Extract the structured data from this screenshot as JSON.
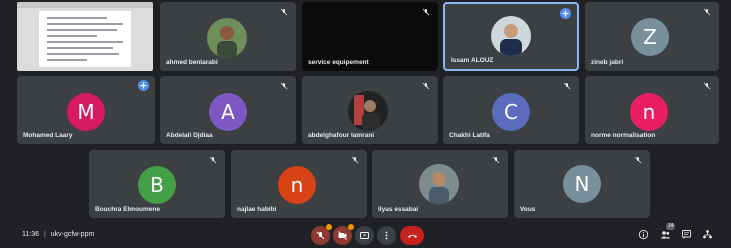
{
  "tiles": [
    {
      "name": "ahmed benlarabi"
    },
    {
      "name": "service equipement"
    },
    {
      "name": "Issam ALOUZ"
    },
    {
      "name": "zineb jabri",
      "initial": "Z",
      "color": "#78909c"
    },
    {
      "name": "Mohamed Laary",
      "initial": "M",
      "color": "#d81b60"
    },
    {
      "name": "Abdelali Djdiaa",
      "initial": "A",
      "color": "#7e57c2"
    },
    {
      "name": "abdelghafour lamrani"
    },
    {
      "name": "Chakhi Latifa",
      "initial": "C",
      "color": "#5c6bc0"
    },
    {
      "name": "norme normalisation",
      "initial": "n",
      "color": "#e91e63"
    },
    {
      "name": "Bouchra Elmoumene",
      "initial": "B",
      "color": "#43a047"
    },
    {
      "name": "najlae habibi",
      "initial": "n",
      "color": "#d84315"
    },
    {
      "name": "ilyas essabai"
    },
    {
      "name": "Vous",
      "initial": "N",
      "color": "#78909c"
    }
  ],
  "bottom": {
    "time": "11:36",
    "separator": "|",
    "meeting_code": "ukv-gcfw-ppm",
    "participant_count": "14"
  },
  "colors": {
    "background": "#202124",
    "tile": "#3c4043",
    "end_call": "#c5221f",
    "active_border": "#8ab4f8"
  }
}
